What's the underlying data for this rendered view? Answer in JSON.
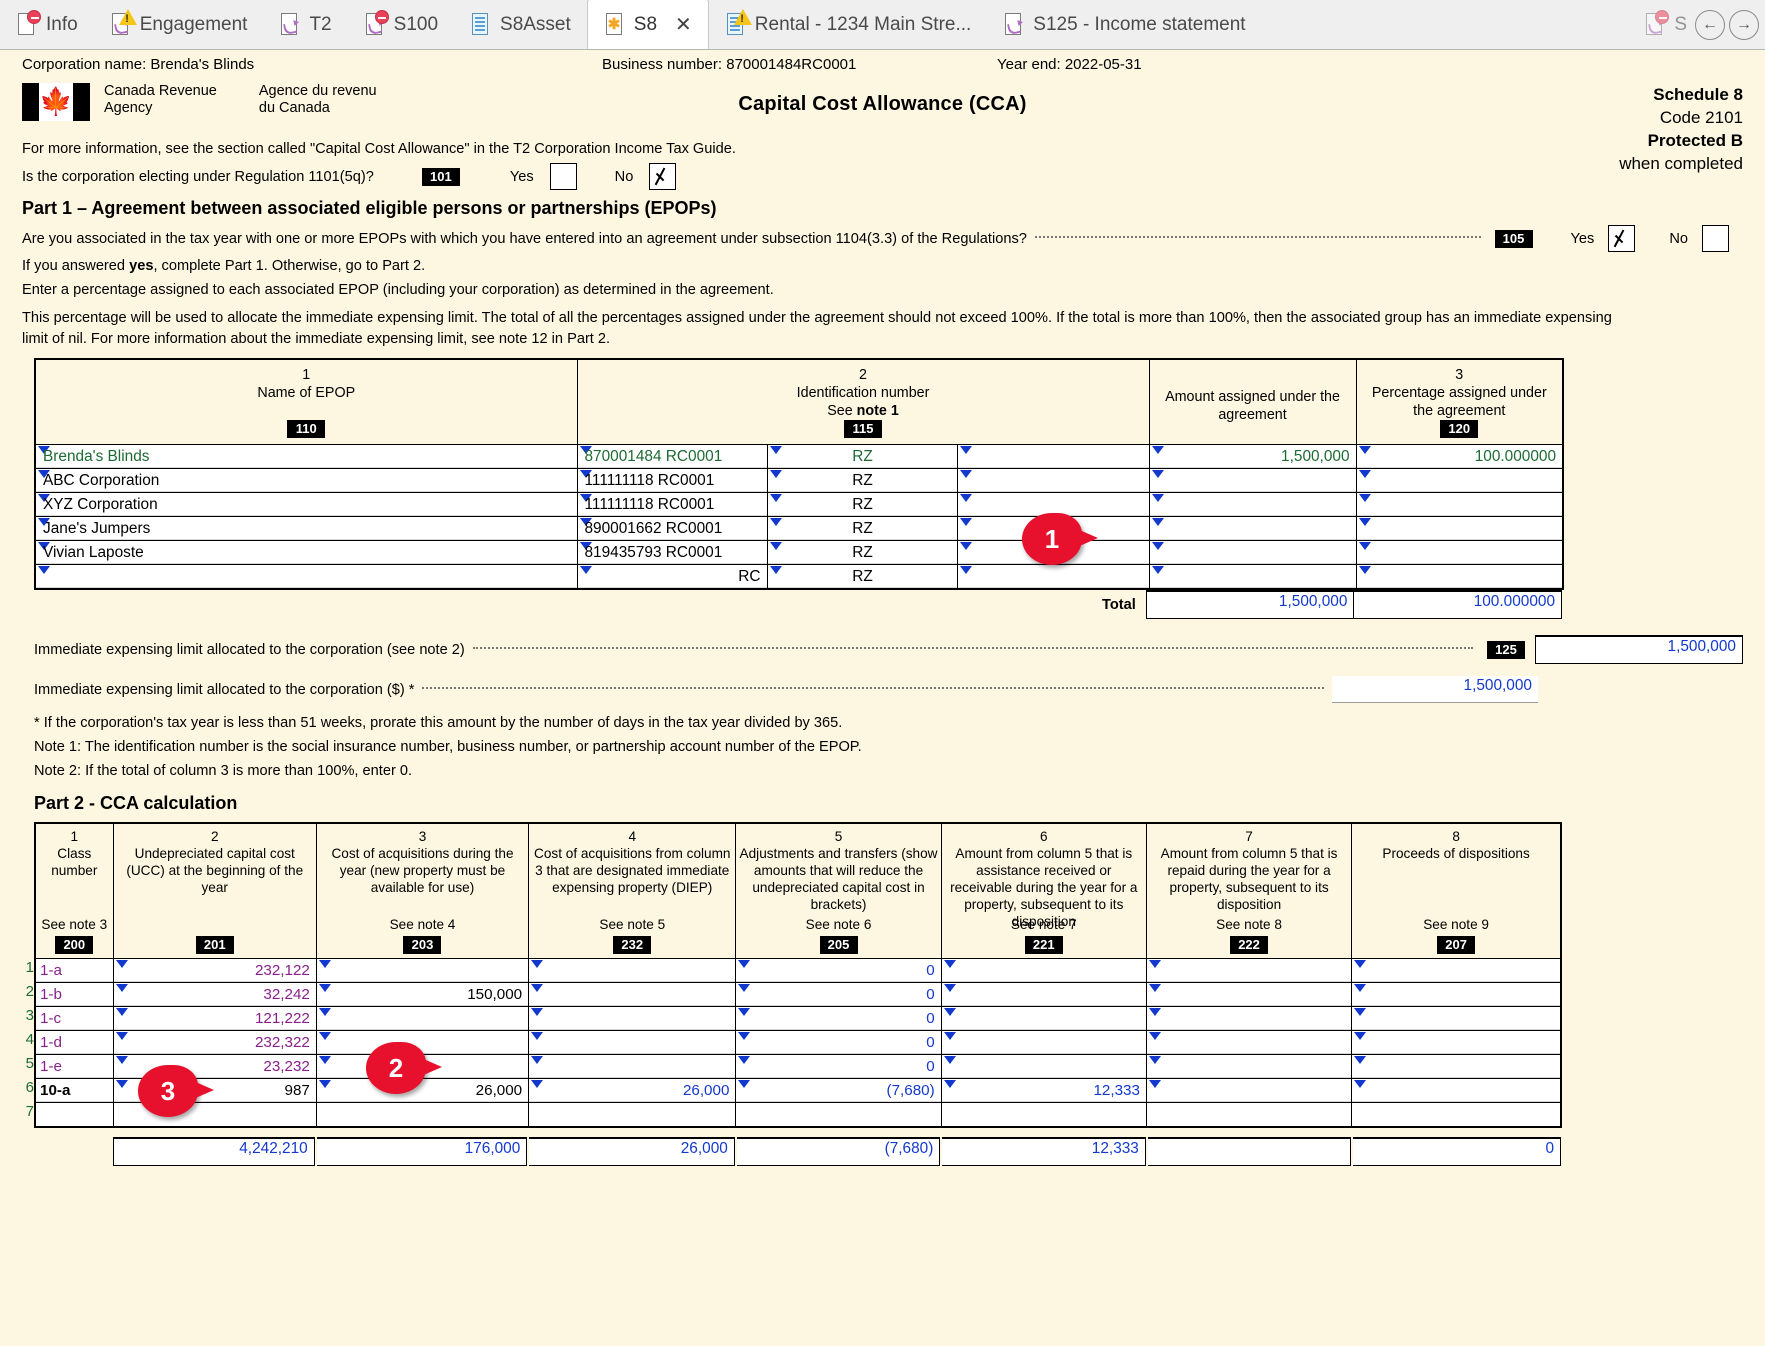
{
  "tabs": [
    {
      "label": "Info",
      "icon": "page-icon",
      "badge": "stop"
    },
    {
      "label": "Engagement",
      "icon": "page-hook-icon",
      "badge": "warn"
    },
    {
      "label": "T2",
      "icon": "page-hook-icon",
      "badge": "none"
    },
    {
      "label": "S100",
      "icon": "page-hook-icon",
      "badge": "stop"
    },
    {
      "label": "S8Asset",
      "icon": "page-lines-icon",
      "badge": "none"
    },
    {
      "label": "S8",
      "icon": "page-star-icon",
      "badge": "none",
      "active": true,
      "close": "✕"
    },
    {
      "label": "Rental - 1234 Main Stre...",
      "icon": "page-lines-icon",
      "badge": "warn"
    },
    {
      "label": "S125 - Income statement",
      "icon": "page-hook-icon",
      "badge": "none"
    },
    {
      "label": "S",
      "icon": "page-hook-icon",
      "badge": "stop",
      "partial": true
    }
  ],
  "nav": {
    "prev": "←",
    "next": "→"
  },
  "header": {
    "corporation_label": "Corporation name: Brenda's Blinds",
    "business_number_label": "Business number: 870001484RC0001",
    "year_end_label": "Year end: 2022-05-31",
    "cra_en": "Canada Revenue\nAgency",
    "cra_en_line1": "Canada Revenue",
    "cra_en_line2": "Agency",
    "cra_fr_line1": "Agence du revenu",
    "cra_fr_line2": "du Canada",
    "title": "Capital Cost Allowance (CCA)",
    "schedule": "Schedule 8",
    "code": "Code 2101",
    "protected": "Protected B",
    "when_completed": "when completed"
  },
  "intro": {
    "more_info": "For more information, see the section called \"Capital Cost Allowance\" in the T2 Corporation Income Tax Guide.",
    "question_101": "Is the corporation electing under Regulation 1101(5q)?",
    "field_101": "101",
    "yes": "Yes",
    "no": "No",
    "q101_yes_checked": false,
    "q101_no_checked": true
  },
  "part1": {
    "heading": "Part 1 – Agreement between associated eligible persons or partnerships (EPOPs)",
    "question_105": "Are you associated in the tax year with one or more EPOPs with which you have entered into an agreement under subsection 1104(3.3) of the Regulations?",
    "field_105": "105",
    "yes": "Yes",
    "no": "No",
    "q105_yes_checked": true,
    "q105_no_checked": false,
    "line_if_yes_a": "If you answered ",
    "line_if_yes_b": "yes",
    "line_if_yes_c": ", complete Part 1. Otherwise, go to Part 2.",
    "line_enter_pct": "Enter a percentage assigned to each associated EPOP (including your corporation) as determined in the agreement.",
    "line_pct_note_1": "This percentage will be used to allocate the immediate expensing limit. The total of all the percentages assigned under the agreement should not exceed 100%. If the total is more than 100%, then the associated group has an immediate expensing",
    "line_pct_note_2": "limit of nil. For more information about the immediate expensing limit, see note 12 in Part 2.",
    "columns": [
      {
        "num": "1",
        "title": "Name of EPOP",
        "field": "110"
      },
      {
        "num": "2",
        "title": "Identification number",
        "subtitle_pre": "See ",
        "subtitle_bold": "note 1",
        "field": "115"
      },
      {
        "num": "",
        "title": "",
        "field": ""
      },
      {
        "num": "",
        "title": "Amount assigned under the agreement",
        "field": ""
      },
      {
        "num": "3",
        "title": "Percentage assigned under the agreement",
        "field": "120"
      }
    ],
    "rows": [
      {
        "name": "Brenda's Blinds",
        "idnum": "870001484 RC0001",
        "prog": "RZ",
        "extra": "",
        "amount": "1,500,000",
        "percent": "100.000000",
        "color": "green"
      },
      {
        "name": "ABC Corporation",
        "idnum": "111111118 RC0001",
        "prog": "RZ",
        "extra": "",
        "amount": "",
        "percent": "",
        "color": "black"
      },
      {
        "name": "XYZ Corporation",
        "idnum": "111111118 RC0001",
        "prog": "RZ",
        "extra": "",
        "amount": "",
        "percent": "",
        "color": "black"
      },
      {
        "name": "Jane's Jumpers",
        "idnum": "890001662 RC0001",
        "prog": "RZ",
        "extra": "",
        "amount": "",
        "percent": "",
        "color": "black"
      },
      {
        "name": "Vivian Laposte",
        "idnum": "819435793 RC0001",
        "prog": "RZ",
        "extra": "",
        "amount": "",
        "percent": "",
        "color": "black"
      },
      {
        "name": "",
        "idnum": "RC",
        "prog": "RZ",
        "extra": "",
        "amount": "",
        "percent": "",
        "color": "black"
      }
    ],
    "total_label": "Total",
    "total_amount": "1,500,000",
    "total_percent": "100.000000",
    "limit_line_1_label": "Immediate expensing limit allocated to the corporation (see note 2)",
    "limit_line_1_field": "125",
    "limit_line_1_value": "1,500,000",
    "limit_line_2_label": "Immediate expensing limit allocated to the corporation ($) *",
    "limit_line_2_value": "1,500,000",
    "footnote_star": "* If the corporation's tax year is less than 51 weeks, prorate this amount by the number of days in the tax year divided by 365.",
    "note_1": "Note 1: The identification number is the social insurance number, business number, or partnership account number of the EPOP.",
    "note_2": "Note 2: If the total of column 3 is more than 100%, enter 0."
  },
  "part2": {
    "heading": "Part 2 - CCA calculation",
    "columns": [
      {
        "num": "1",
        "title": "Class number",
        "seenote": "See note 3",
        "field": "200"
      },
      {
        "num": "2",
        "title": "Undepreciated capital cost (UCC) at the beginning of the year",
        "seenote": "",
        "field": "201"
      },
      {
        "num": "3",
        "title": "Cost of acquisitions during the year (new property must be available for use)",
        "seenote": "See note 4",
        "field": "203"
      },
      {
        "num": "4",
        "title": "Cost of acquisitions from column 3 that are designated immediate expensing property (DIEP)",
        "seenote": "See note 5",
        "field": "232"
      },
      {
        "num": "5",
        "title": "Adjustments and transfers (show amounts that will reduce the undepreciated capital cost in brackets)",
        "seenote": "See note 6",
        "field": "205"
      },
      {
        "num": "6",
        "title": "Amount from column 5 that is assistance received or receivable during the year for a property, subsequent to its disposition",
        "seenote": "See note 7",
        "field": "221"
      },
      {
        "num": "7",
        "title": "Amount from column 5 that is repaid during the year for a property, subsequent to its disposition",
        "seenote": "See note 8",
        "field": "222"
      },
      {
        "num": "8",
        "title": "Proceeds of dispositions",
        "seenote": "See note 9",
        "field": "207"
      }
    ],
    "rows": [
      {
        "n": "1",
        "c1": "1-a",
        "c2": "232,122",
        "c3": "",
        "c4": "",
        "c5": "0",
        "c6": "",
        "c7": "",
        "c8": ""
      },
      {
        "n": "2",
        "c1": "1-b",
        "c2": "32,242",
        "c3": "150,000",
        "c4": "",
        "c5": "0",
        "c6": "",
        "c7": "",
        "c8": ""
      },
      {
        "n": "3",
        "c1": "1-c",
        "c2": "121,222",
        "c3": "",
        "c4": "",
        "c5": "0",
        "c6": "",
        "c7": "",
        "c8": ""
      },
      {
        "n": "4",
        "c1": "1-d",
        "c2": "232,322",
        "c3": "",
        "c4": "",
        "c5": "0",
        "c6": "",
        "c7": "",
        "c8": ""
      },
      {
        "n": "5",
        "c1": "1-e",
        "c2": "23,232",
        "c3": "",
        "c4": "",
        "c5": "0",
        "c6": "",
        "c7": "",
        "c8": ""
      },
      {
        "n": "6",
        "c1": "10-a",
        "c2": "987",
        "c3": "26,000",
        "c4": "26,000",
        "c5": "(7,680)",
        "c6": "12,333",
        "c7": "",
        "c8": ""
      },
      {
        "n": "7",
        "c1": "",
        "c2": "",
        "c3": "",
        "c4": "",
        "c5": "",
        "c6": "",
        "c7": "",
        "c8": ""
      }
    ],
    "totals": {
      "c2": "4,242,210",
      "c3": "176,000",
      "c4": "26,000",
      "c5": "(7,680)",
      "c6": "12,333",
      "c7": "",
      "c8": "0"
    }
  },
  "callouts": [
    {
      "number": "1"
    },
    {
      "number": "2"
    },
    {
      "number": "3"
    }
  ],
  "colors": {
    "page_bg": "#fdf6e0",
    "entered_value": "#1338ce",
    "calculated_green": "#1d6b33",
    "override_purple": "#8a1f8a",
    "callout_red": "#e8112d"
  }
}
